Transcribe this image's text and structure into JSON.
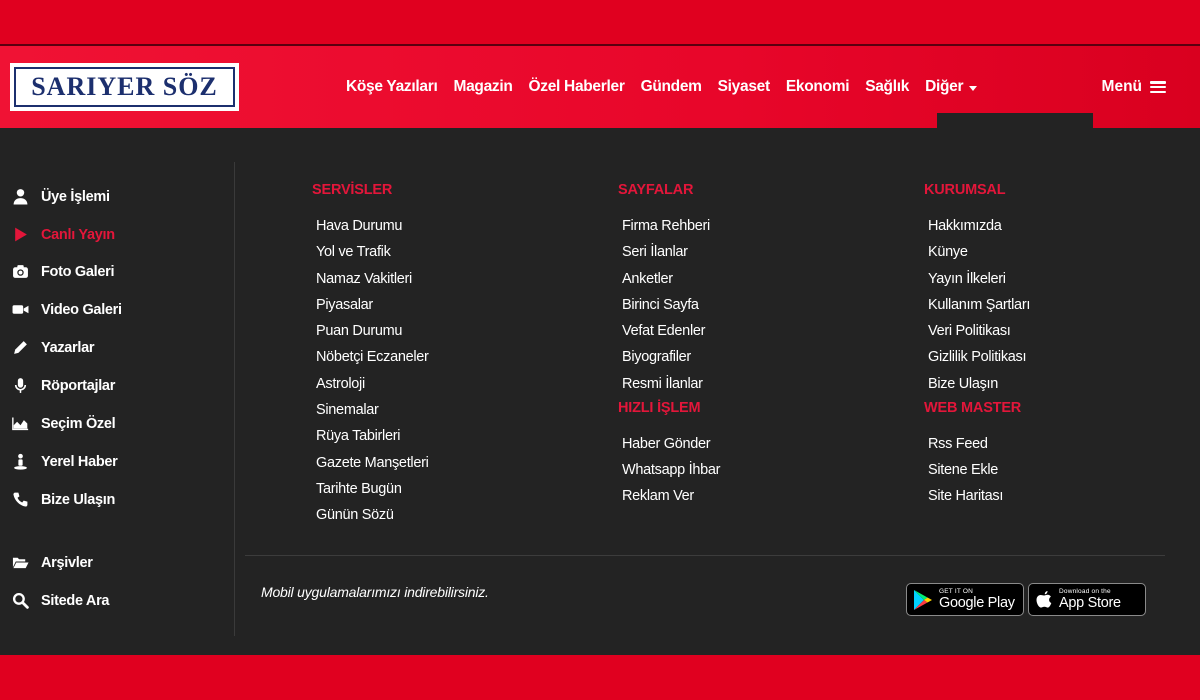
{
  "brand": {
    "logo_text": "SARIYER SÖZ"
  },
  "nav": {
    "items": [
      "Köşe Yazıları",
      "Magazin",
      "Özel Haberler",
      "Gündem",
      "Siyaset",
      "Ekonomi",
      "Sağlık"
    ],
    "more_label": "Diğer",
    "menu_label": "Menü"
  },
  "sidebar": {
    "items": [
      {
        "label": "Üye İşlemi",
        "icon": "user-icon"
      },
      {
        "label": "Canlı Yayın",
        "icon": "play-icon",
        "active": true
      },
      {
        "label": "Foto Galeri",
        "icon": "camera-icon"
      },
      {
        "label": "Video Galeri",
        "icon": "video-camera-icon"
      },
      {
        "label": "Yazarlar",
        "icon": "pencil-icon"
      },
      {
        "label": "Röportajlar",
        "icon": "microphone-icon"
      },
      {
        "label": "Seçim Özel",
        "icon": "area-chart-icon"
      },
      {
        "label": "Yerel Haber",
        "icon": "street-view-icon"
      },
      {
        "label": "Bize Ulaşın",
        "icon": "phone-icon"
      }
    ],
    "bottom_items": [
      {
        "label": "Arşivler",
        "icon": "folder-open-icon"
      },
      {
        "label": "Sitede Ara",
        "icon": "search-icon"
      }
    ]
  },
  "columns": {
    "servisler": {
      "title": "SERVİSLER",
      "links": [
        "Hava Durumu",
        "Yol ve Trafik",
        "Namaz Vakitleri",
        "Piyasalar",
        "Puan Durumu",
        "Nöbetçi Eczaneler",
        "Astroloji",
        "Sinemalar",
        "Rüya Tabirleri",
        "Gazete Manşetleri",
        "Tarihte Bugün",
        "Günün Sözü"
      ]
    },
    "sayfalar": {
      "title": "SAYFALAR",
      "links": [
        "Firma Rehberi",
        "Seri İlanlar",
        "Anketler",
        "Birinci Sayfa",
        "Vefat Edenler",
        "Biyografiler",
        "Resmi İlanlar"
      ]
    },
    "hizli_islem": {
      "title": "HIZLI İŞLEM",
      "links": [
        "Haber Gönder",
        "Whatsapp İhbar",
        "Reklam Ver"
      ]
    },
    "kurumsal": {
      "title": "KURUMSAL",
      "links": [
        "Hakkımızda",
        "Künye",
        "Yayın İlkeleri",
        "Kullanım Şartları",
        "Veri Politikası",
        "Gizlilik Politikası",
        "Bize Ulaşın"
      ]
    },
    "web_master": {
      "title": "WEB MASTER",
      "links": [
        "Rss Feed",
        "Sitene Ekle",
        "Site Haritası"
      ]
    }
  },
  "footer": {
    "mobile_text": "Mobil uygulamalarımızı indirebilirsiniz.",
    "google_play": {
      "small": "GET IT ON",
      "big": "Google Play"
    },
    "app_store": {
      "small": "Download on the",
      "big": "App Store"
    }
  },
  "colors": {
    "brand_red": "#e0001f",
    "accent_red": "#e3163a",
    "panel_bg": "#232323",
    "logo_blue": "#1c2f6e"
  }
}
